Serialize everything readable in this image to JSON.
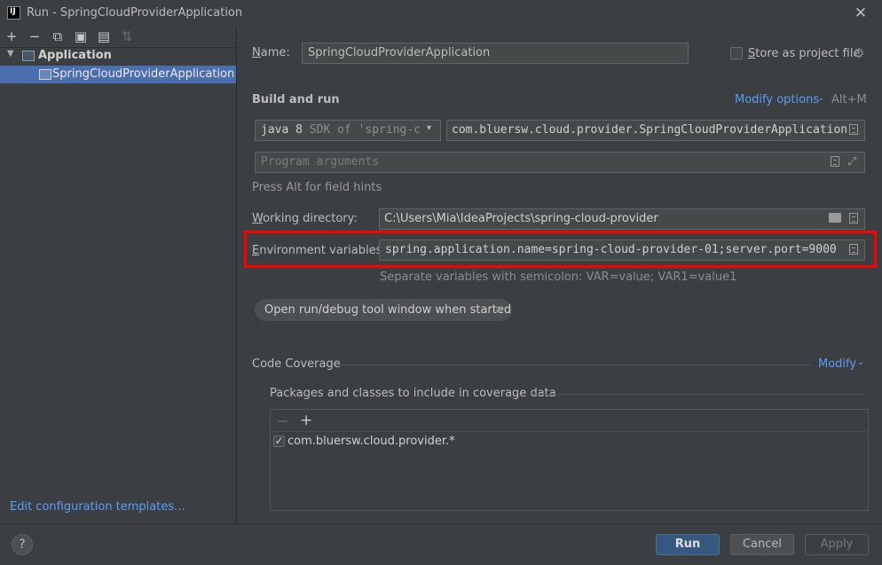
{
  "window": {
    "logo_text": "IJ",
    "title": "Run - SpringCloudProviderApplication",
    "close_glyph": "✕"
  },
  "tree_toolbar": {
    "icons": [
      "add-icon",
      "remove-icon",
      "copy-icon",
      "save-icon",
      "new-folder-icon",
      "sort-icon"
    ],
    "add_glyph": "+",
    "remove_glyph": "−",
    "copy_glyph": "⧉",
    "save_glyph": "▣",
    "folder_glyph": "▤",
    "sort_glyph": "⇅"
  },
  "tree": {
    "group_label": "Application",
    "expand_glyph": "▼",
    "items": [
      {
        "label": "SpringCloudProviderApplication"
      }
    ]
  },
  "left_footer": {
    "edit_templates": "Edit configuration templates..."
  },
  "form": {
    "name_label": "Name:",
    "name_value": "SpringCloudProviderApplication",
    "store_label": "Store as project file",
    "gear_glyph": "⚙",
    "build_title": "Build and run",
    "modify_options": "Modify options",
    "modify_shortcut": "Alt+M",
    "dropdown_glyph": "⌄",
    "jdk_value": "java 8",
    "jdk_hint": "SDK of 'spring-clou",
    "jdk_arrow": "▾",
    "main_class": "com.bluersw.cloud.provider.SpringCloudProviderApplication",
    "program_args_placeholder": "Program arguments",
    "expand_glyph": "⤢",
    "alt_hint": "Press Alt for field hints",
    "working_dir_label": "Working directory:",
    "working_dir_value": "C:\\Users\\Mia\\IdeaProjects\\spring-cloud-provider",
    "env_label": "Environment variables:",
    "env_value": "spring.application.name=spring-cloud-provider-01;server.port=9000",
    "env_hint": "Separate variables with semicolon: VAR=value; VAR1=value1",
    "open_tool_window": "Open run/debug tool window when started",
    "chip_close_glyph": "✕"
  },
  "coverage": {
    "title": "Code Coverage",
    "modify": "Modify",
    "packages_title": "Packages and classes to include in coverage data",
    "minus_glyph": "−",
    "plus_glyph": "+",
    "check_glyph": "✓",
    "packages": [
      {
        "label": "com.bluersw.cloud.provider.*",
        "checked": true
      }
    ]
  },
  "buttons": {
    "help": "?",
    "run": "Run",
    "cancel": "Cancel",
    "apply": "Apply"
  },
  "colors": {
    "background": "#3c3f41",
    "selection": "#4b6eaf",
    "link": "#589df6",
    "highlight": "#ff0000",
    "primary_button": "#365880"
  }
}
